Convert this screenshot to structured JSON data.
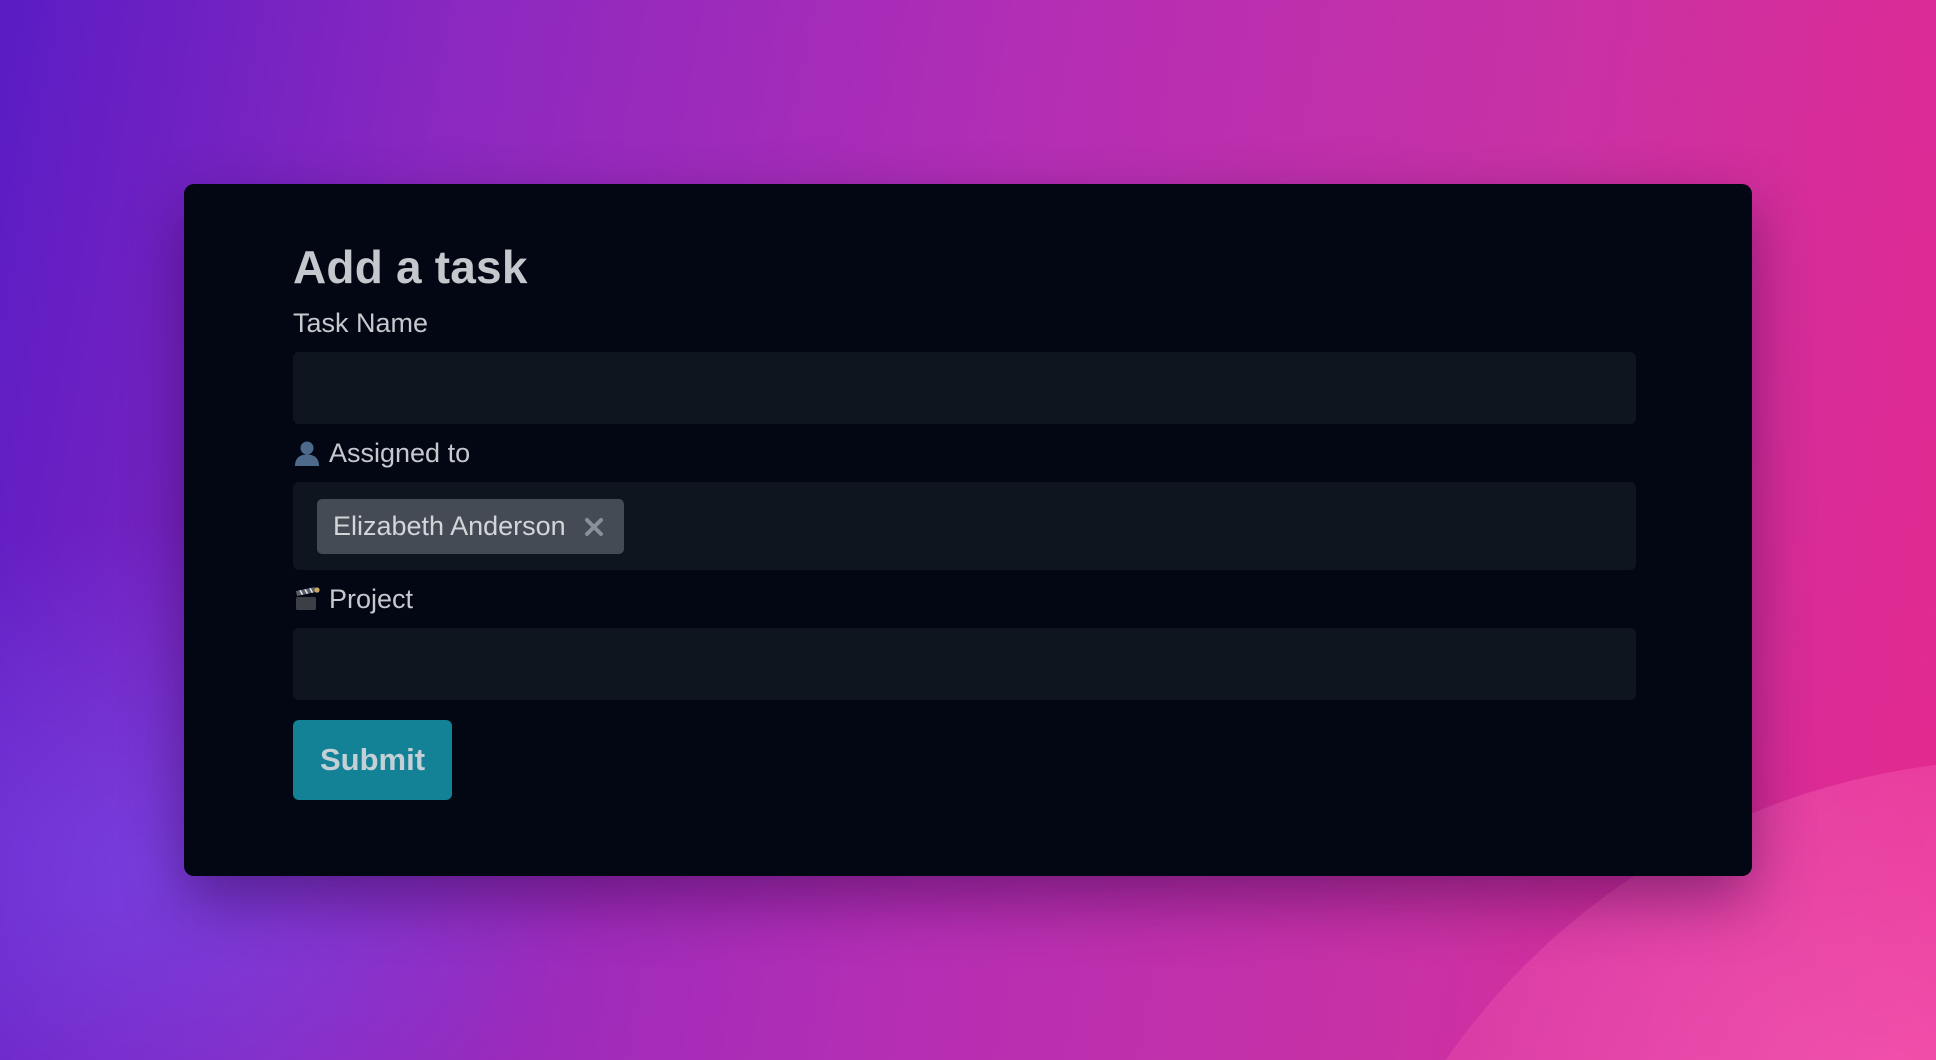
{
  "form": {
    "title": "Add a task",
    "task_name": {
      "label": "Task Name",
      "value": ""
    },
    "assigned_to": {
      "icon": "person-silhouette-icon",
      "label": "Assigned to",
      "selected": [
        {
          "name": "Elizabeth Anderson",
          "remove_icon": "close-x-icon"
        }
      ]
    },
    "project": {
      "icon": "clapper-board-icon",
      "label": "Project",
      "value": ""
    },
    "submit_label": "Submit"
  },
  "colors": {
    "card_background": "#020713",
    "input_background": "#0f151f",
    "tag_background": "#444b55",
    "submit_button": "#138196",
    "text": "#c5c8cd"
  }
}
